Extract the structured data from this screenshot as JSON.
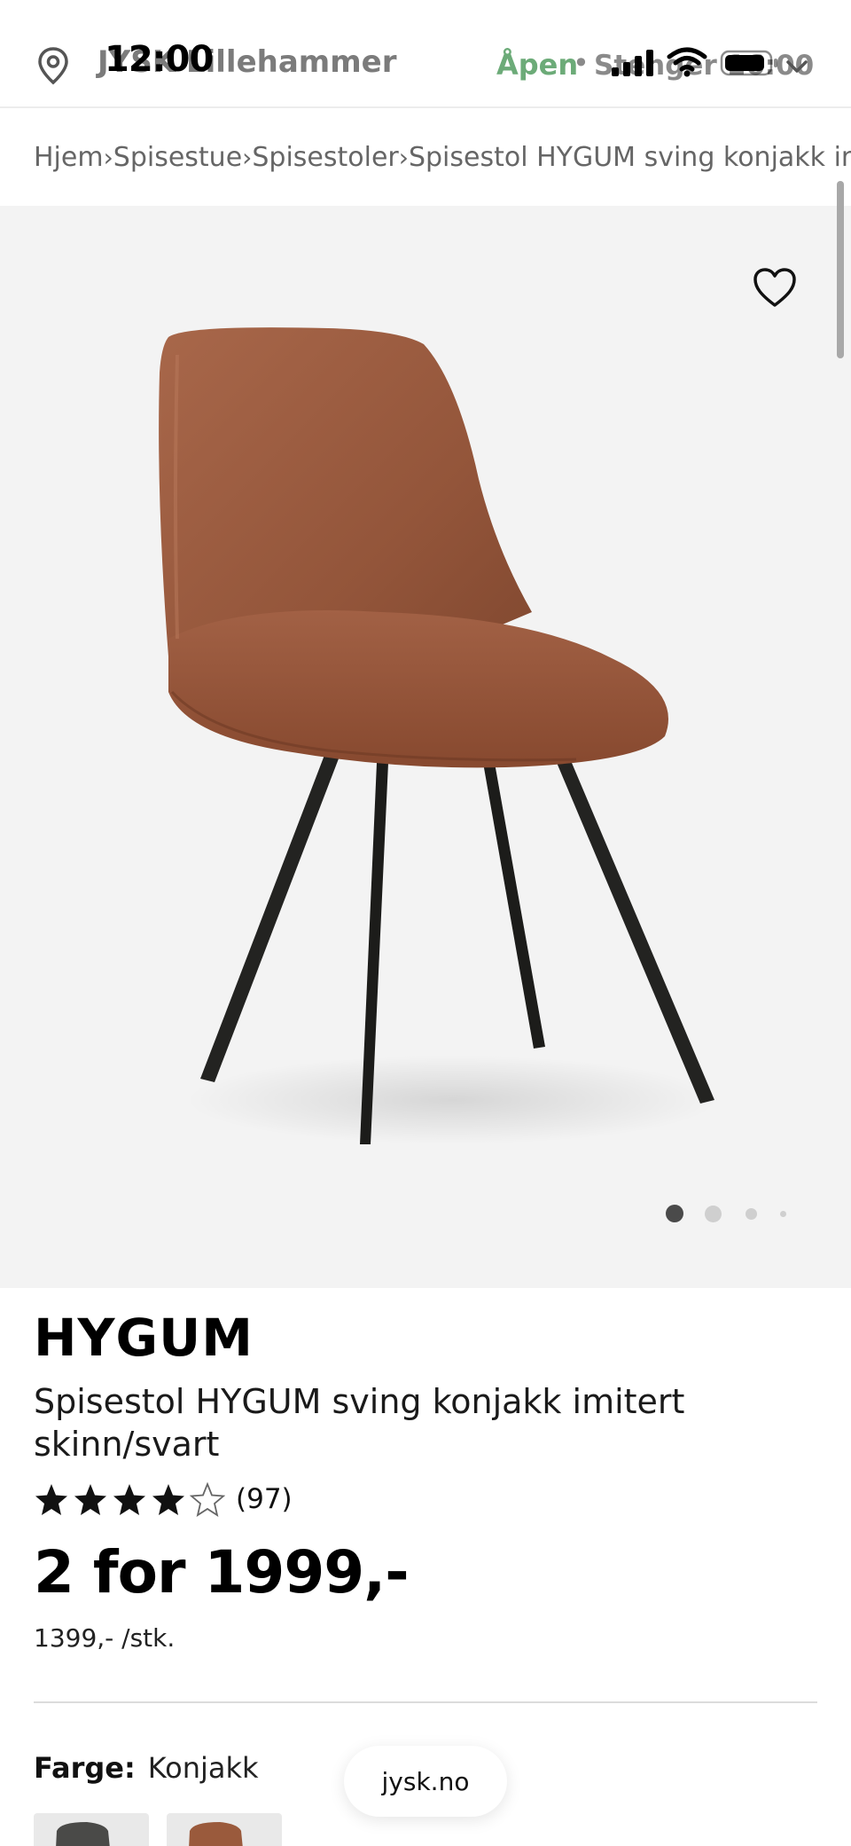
{
  "status_bar": {
    "time": "12:00"
  },
  "store": {
    "name": "JYSK Lillehammer",
    "open_label": "Åpen",
    "separator": "•",
    "hours": "Stenger 16:00"
  },
  "breadcrumb": {
    "separator": "›",
    "items": [
      "Hjem",
      "Spisestue",
      "Spisestoler",
      "Spisestol HYGUM sving konjakk imitert skinn/svart"
    ]
  },
  "gallery": {
    "image_count": 4,
    "active_index": 0
  },
  "product": {
    "brand": "HYGUM",
    "title": "Spisestol HYGUM sving konjakk imitert skinn/svart",
    "rating": 4.5,
    "rating_count": "(97)",
    "price": "2 for 1999,-",
    "unit_price": "1399,- /stk.",
    "color_label": "Farge:",
    "color_value": "Konjakk"
  },
  "browser": {
    "domain": "jysk.no"
  },
  "colors": {
    "open_green": "#6cab78",
    "leather": "#9a5a3c",
    "legs": "#1c1c1a",
    "gallery_bg": "#f3f3f3"
  }
}
